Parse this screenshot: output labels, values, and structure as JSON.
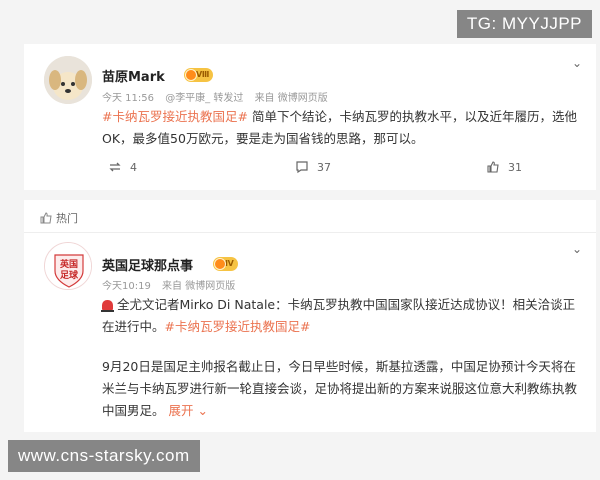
{
  "watermarks": {
    "top": "TG: MYYJJPP",
    "bottom": "www.cns-starsky.com"
  },
  "post1": {
    "author": "苗原Mark",
    "level_badge": "Ⅷ",
    "time": "今天 11:56",
    "repost_from": "@李平康_ 转发过",
    "source": "来自 微博网页版",
    "hashtag": "#卡纳瓦罗接近执教国足#",
    "body": "简单下个结论，卡纳瓦罗的执教水平，以及近年履历，选他OK，最多值50万欧元，要是走为国省钱的思路，那可以。",
    "repost_count": "4",
    "comment_count": "37",
    "like_count": "31"
  },
  "post2": {
    "section_label": "热门",
    "author": "英国足球那点事",
    "level_badge": "Ⅳ",
    "time": "今天10:19",
    "source": "来自 微博网页版",
    "avatar_text_top": "英国",
    "avatar_text_bottom": "足球",
    "line1": "全尤文记者Mirko Di Natale：卡纳瓦罗执教中国国家队接近达成协议！相关洽谈正在进行中。",
    "hashtag": "#卡纳瓦罗接近执教国足#",
    "line2": "9月20日是国足主帅报名截止日，今日早些时候，斯基拉透露，中国足协预计今天将在米兰与卡纳瓦罗进行新一轮直接会谈，足协将提出新的方案来说服这位意大利教练执教中国男足。",
    "expand_label": "展开",
    "expand_icon": "chevron-down-icon"
  },
  "colors": {
    "tag": "#eb7350",
    "badge": "#f6c343"
  }
}
